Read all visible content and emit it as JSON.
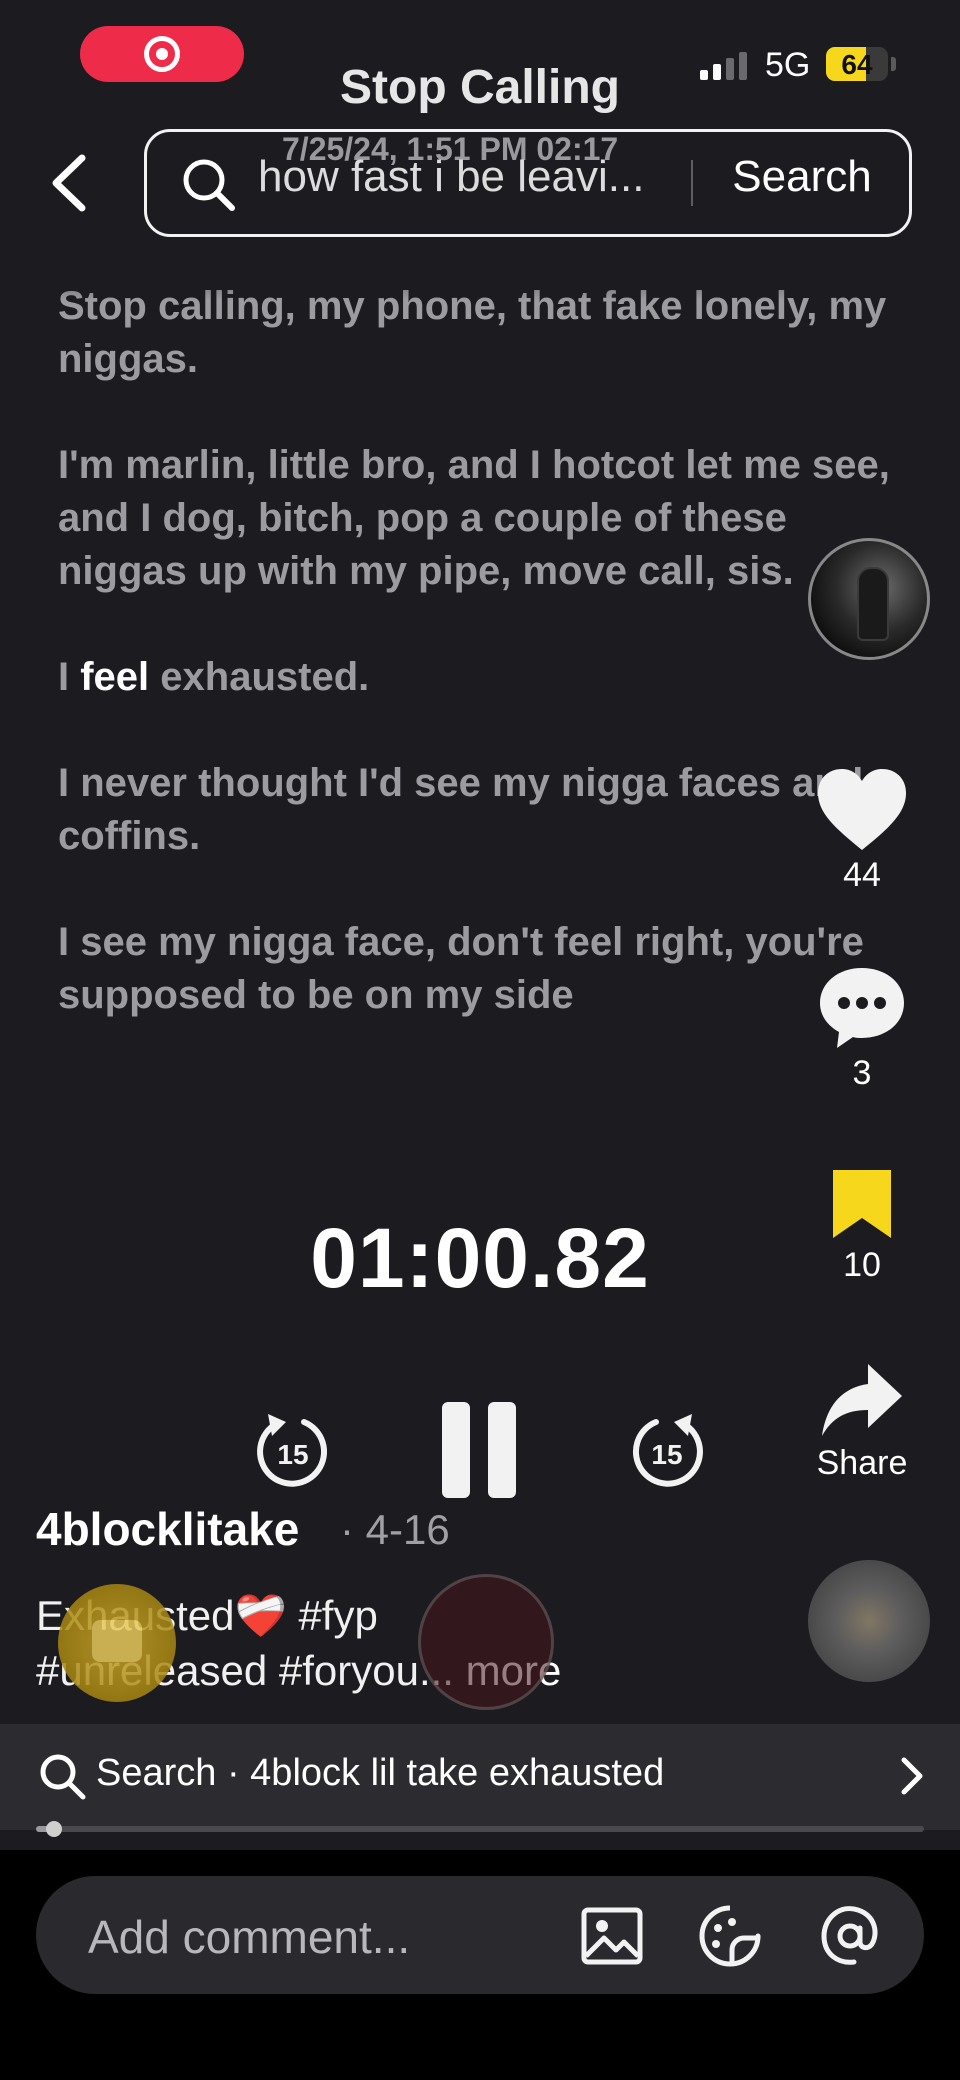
{
  "status_bar": {
    "title": "Stop Calling",
    "network": "5G",
    "battery": "64",
    "battery_level": 0.64
  },
  "header": {
    "timestamp": "7/25/24, 1:51 PM  02:17",
    "search_query": "how fast i be leavi...",
    "search_button": "Search"
  },
  "lyrics": {
    "lines": [
      "Stop calling, my phone, that fake lonely, my niggas.",
      "I'm marlin, little bro, and I hotcot let me see, and I dog, bitch, pop a couple of these niggas up with my pipe, move call, sis.",
      "I never thought I'd see my nigga faces and coffins.",
      "I see my nigga face, don't feel right, you're supposed to be on my side"
    ],
    "highlighted_line": {
      "before": "I ",
      "word": "feel",
      "after": " exhausted."
    }
  },
  "actions": {
    "likes": "44",
    "comments": "3",
    "bookmarks": "10",
    "share": "Share"
  },
  "player": {
    "time": "01:00.82",
    "rewind_seconds": "15",
    "forward_seconds": "15"
  },
  "post": {
    "author": "4blocklitake",
    "date": "· 4-16",
    "caption_line1": "Exhausted",
    "caption_emoji": "❤️‍🩹",
    "caption_tag1": " #fyp",
    "caption_line2": "#unreleased #foryou...",
    "more": "more"
  },
  "related_search": {
    "label": "Search · 4block lil take exhausted",
    "progress": 0.02
  },
  "comment": {
    "placeholder": "Add comment..."
  },
  "icons": {
    "back": "chevron-left-icon",
    "search": "search-icon",
    "like": "heart-icon",
    "comment": "comment-dots-icon",
    "bookmark": "bookmark-icon",
    "share": "share-arrow-icon",
    "rewind": "rewind-15-icon",
    "pause": "pause-icon",
    "forward": "forward-15-icon",
    "image": "image-icon",
    "emoji": "emoji-icon",
    "mention": "at-sign-icon"
  },
  "colors": {
    "background": "#1c1b20",
    "record": "#ee2c4a",
    "battery": "#f6d71b",
    "bookmark": "#f6d71b",
    "lyric_dim": "#9b9ba0"
  }
}
